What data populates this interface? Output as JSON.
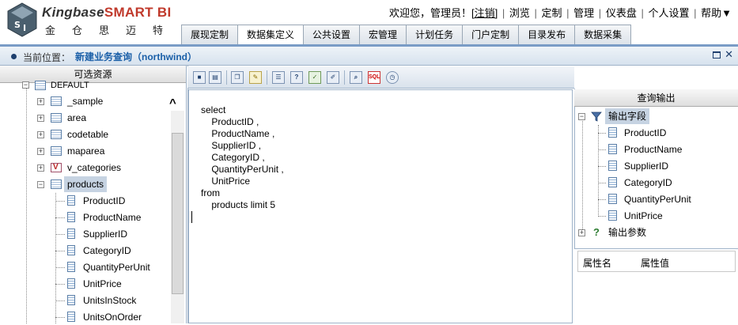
{
  "header": {
    "brand_main": "Kingbase",
    "brand_accent": "SMART BI",
    "brand_cn": "金仓思迈特",
    "welcome": "欢迎您，管理员！",
    "logout": "[注销]",
    "nav": [
      "浏览",
      "定制",
      "管理",
      "仪表盘",
      "个人设置"
    ],
    "help": "帮助▼"
  },
  "tabs": [
    "展现定制",
    "数据集定义",
    "公共设置",
    "宏管理",
    "计划任务",
    "门户定制",
    "目录发布",
    "数据采集"
  ],
  "active_tab": 1,
  "location": {
    "label": "当前位置：",
    "title": "新建业务查询（northwind）"
  },
  "left_panel": {
    "title": "可选资源",
    "partial_top": "DEFAULT",
    "tables": [
      "_sample",
      "area",
      "codetable",
      "maparea",
      "v_categories",
      "products"
    ],
    "selected_table": "products",
    "fields": [
      "ProductID",
      "ProductName",
      "SupplierID",
      "CategoryID",
      "QuantityPerUnit",
      "UnitPrice",
      "UnitsInStock",
      "UnitsOnOrder"
    ]
  },
  "toolbar": {
    "buttons": [
      "save-icon",
      "save-as-icon",
      "copy-icon",
      "clear-icon",
      "table-icon",
      "param-icon",
      "check-icon",
      "edit-icon",
      "search-icon",
      "sql-icon",
      "clock-icon"
    ],
    "sql_label": "SQL"
  },
  "editor": {
    "sql": "select\n    ProductID ,\n    ProductName ,\n    SupplierID ,\n    CategoryID ,\n    QuantityPerUnit ,\n    UnitPrice\nfrom\n    products limit 5"
  },
  "right_panel": {
    "title": "查询输出",
    "output_fields_label": "输出字段",
    "output_fields": [
      "ProductID",
      "ProductName",
      "SupplierID",
      "CategoryID",
      "QuantityPerUnit",
      "UnitPrice"
    ],
    "output_params_label": "输出参数",
    "prop_name": "属性名",
    "prop_value": "属性值"
  },
  "colors": {
    "accent": "#1a5fa8",
    "brand_red": "#c0392b",
    "selection": "#c6d3e2"
  }
}
